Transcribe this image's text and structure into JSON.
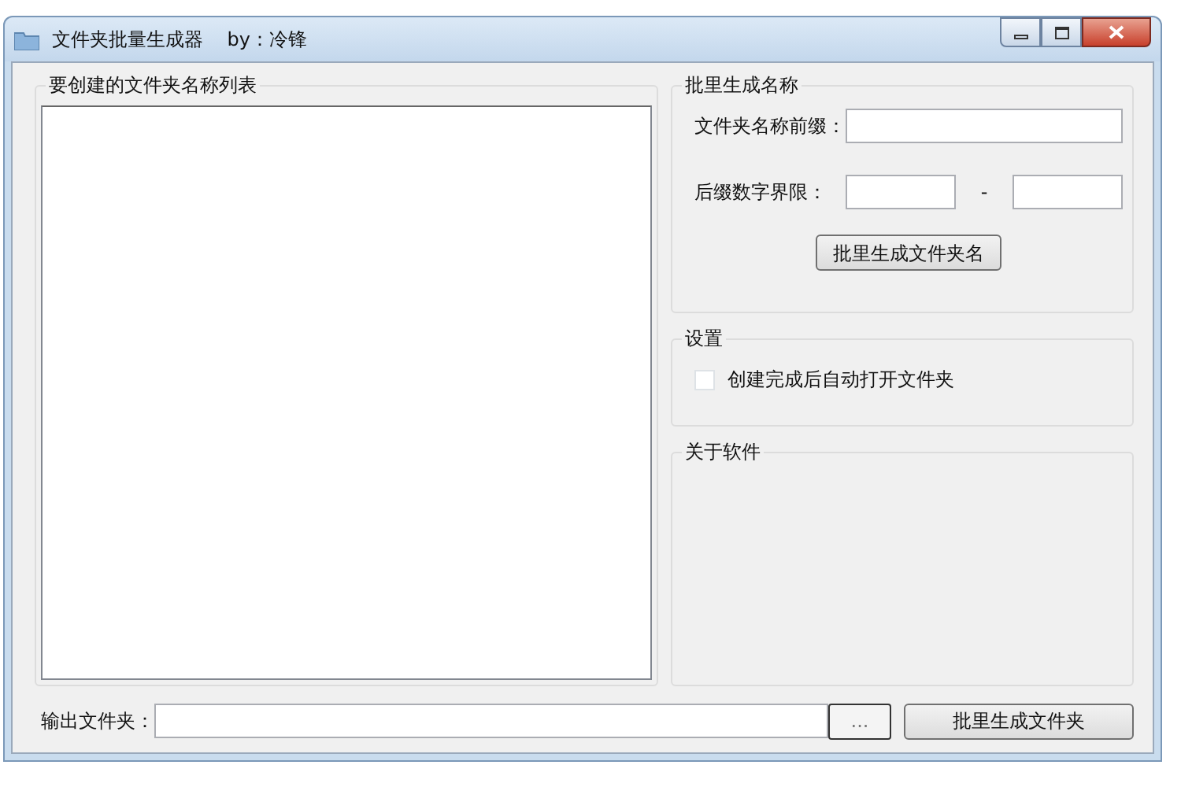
{
  "window": {
    "title": "文件夹批量生成器    by：冷锋"
  },
  "list_group": {
    "title": "要创建的文件夹名称列表"
  },
  "name_group": {
    "title": "批里生成名称",
    "prefix_label": "文件夹名称前缀：",
    "range_label": "后缀数字界限：",
    "range_separator": "-",
    "generate_button": "批里生成文件夹名"
  },
  "settings_group": {
    "title": "设置",
    "options": [
      {
        "label": "创建完成后自动打开文件夹",
        "checked": false
      }
    ]
  },
  "about_group": {
    "title": "关于软件"
  },
  "footer": {
    "output_label": "输出文件夹：",
    "browse_button": "...",
    "create_button": "批里生成文件夹"
  }
}
